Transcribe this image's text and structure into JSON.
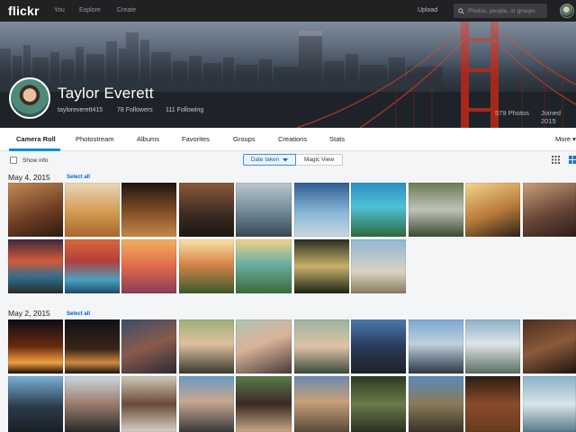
{
  "brand": {
    "logo": "flickr"
  },
  "nav": {
    "you": "You",
    "explore": "Explore",
    "create": "Create",
    "upload": "Upload"
  },
  "search": {
    "placeholder": "Photos, people, or groups"
  },
  "profile": {
    "name": "Taylor Everett",
    "username": "tayloreverett415",
    "followers": "78 Followers",
    "following": "111 Following",
    "photos": "579 Photos",
    "joined": "Joined 2015"
  },
  "tabs": [
    "Camera Roll",
    "Photostream",
    "Albums",
    "Favorites",
    "Groups",
    "Creations",
    "Stats"
  ],
  "more": "More ▾",
  "toolbar": {
    "show_info": "Show info",
    "date_taken": "Date taken",
    "magic_view": "Magic View"
  },
  "sections": [
    {
      "date": "May 4, 2015",
      "select_all": "Select all"
    },
    {
      "date": "May 2, 2015",
      "select_all": "Select all"
    }
  ],
  "colors": {
    "accent": "#008ecf",
    "topnav": "#212124",
    "link": "#0063dc"
  },
  "icons": [
    "search-icon",
    "checkbox-icon",
    "chevron-down-icon",
    "grid-small-icon",
    "grid-large-icon"
  ]
}
